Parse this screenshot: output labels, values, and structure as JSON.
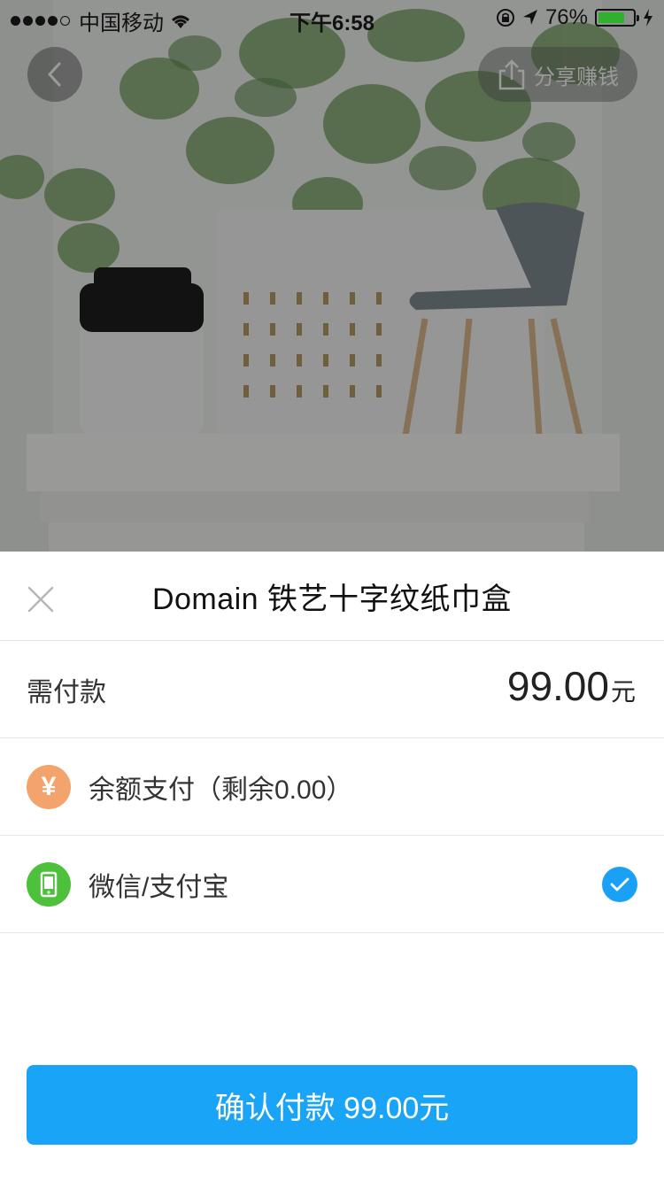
{
  "status_bar": {
    "carrier": "中国移动",
    "time": "下午6:58",
    "battery_percent": "76%",
    "battery_level": 0.76,
    "icons": [
      "signal-dots-icon",
      "wifi-icon",
      "rotation-lock-icon",
      "location-icon",
      "battery-icon",
      "charging-icon"
    ]
  },
  "header": {
    "back_icon": "chevron-left-icon",
    "share_label": "分享赚钱",
    "share_icon": "share-icon"
  },
  "hero": {
    "image_description_icon": "product-photo"
  },
  "sheet": {
    "close_icon": "close-icon",
    "title": "Domain 铁艺十字纹纸巾盒",
    "amount_label": "需付款",
    "amount_value": "99.00",
    "amount_unit": "元",
    "methods": [
      {
        "label": "余额支付（剩余0.00）",
        "icon": "yen-icon",
        "icon_glyph": "¥",
        "icon_color": "#f3a46c",
        "selected": false
      },
      {
        "label": "微信/支付宝",
        "icon": "phone-icon",
        "icon_color": "#4dc13b",
        "selected": true
      }
    ],
    "confirm_label": "确认付款 99.00元",
    "accent_color": "#1aa4f8"
  }
}
